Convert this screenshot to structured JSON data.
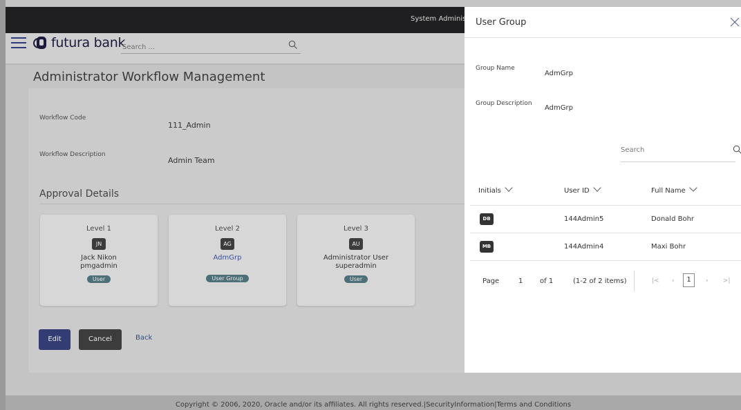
{
  "topbar": {
    "user_label": "System Administ"
  },
  "header": {
    "logo_text": "futura bank",
    "search_placeholder": "Search ..."
  },
  "page": {
    "title": "Administrator Workflow Management",
    "fields": [
      {
        "label": "Workflow Code",
        "value": "111_Admin"
      },
      {
        "label": "Workflow Description",
        "value": "Admin Team"
      }
    ],
    "approval_title": "Approval Details",
    "levels": [
      {
        "level": "Level 1",
        "initials": "JN",
        "name_line1": "Jack Nikon",
        "name_line2": "pmgadmin",
        "badge": "User"
      },
      {
        "level": "Level 2",
        "initials": "AG",
        "name_line1": "AdmGrp",
        "name_line2": "",
        "badge": "User Group"
      },
      {
        "level": "Level 3",
        "initials": "AU",
        "name_line1": "Administrator User",
        "name_line2": "superadmin",
        "badge": "User"
      }
    ],
    "buttons": {
      "edit": "Edit",
      "cancel": "Cancel",
      "back": "Back"
    }
  },
  "footer": {
    "text": "Copyright © 2006, 2020, Oracle and/or its affiliates. All rights reserved.|SecurityInformation|Terms and Conditions"
  },
  "panel": {
    "title": "User Group",
    "group_name_label": "Group Name",
    "group_name_value": "AdmGrp",
    "group_desc_label": "Group Description",
    "group_desc_value": "AdmGrp",
    "search_placeholder": "Search",
    "columns": [
      "Initials",
      "User ID",
      "Full Name"
    ],
    "rows": [
      {
        "initials": "DB",
        "user_id": "144Admin5",
        "full_name": "Donald Bohr"
      },
      {
        "initials": "MB",
        "user_id": "144Admin4",
        "full_name": "Maxi Bohr"
      }
    ],
    "pagination": {
      "page_label": "Page",
      "page_value": "1",
      "of_label": "of 1",
      "items_label": "(1-2 of 2 items)",
      "current": "1",
      "first": "|<",
      "prev": "‹",
      "next": "›",
      "last": ">|"
    }
  }
}
